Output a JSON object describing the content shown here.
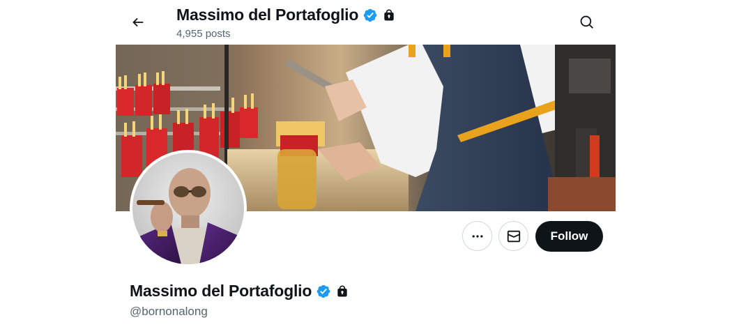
{
  "header": {
    "name": "Massimo del Portafoglio",
    "posts_count": "4,955 posts",
    "back_icon": "arrow-left-icon",
    "search_icon": "search-icon"
  },
  "profile": {
    "display_name": "Massimo del Portafoglio",
    "handle": "@bornonalong",
    "verified_icon": "verified-badge-icon",
    "protected_icon": "lock-icon",
    "verified_color": "#1d9bf0"
  },
  "actions": {
    "more_icon": "more-icon",
    "message_icon": "mail-icon",
    "follow_label": "Follow"
  },
  "colors": {
    "text_primary": "#0f1419",
    "text_secondary": "#536471",
    "follow_bg": "#0f1419",
    "verified": "#1d9bf0"
  }
}
